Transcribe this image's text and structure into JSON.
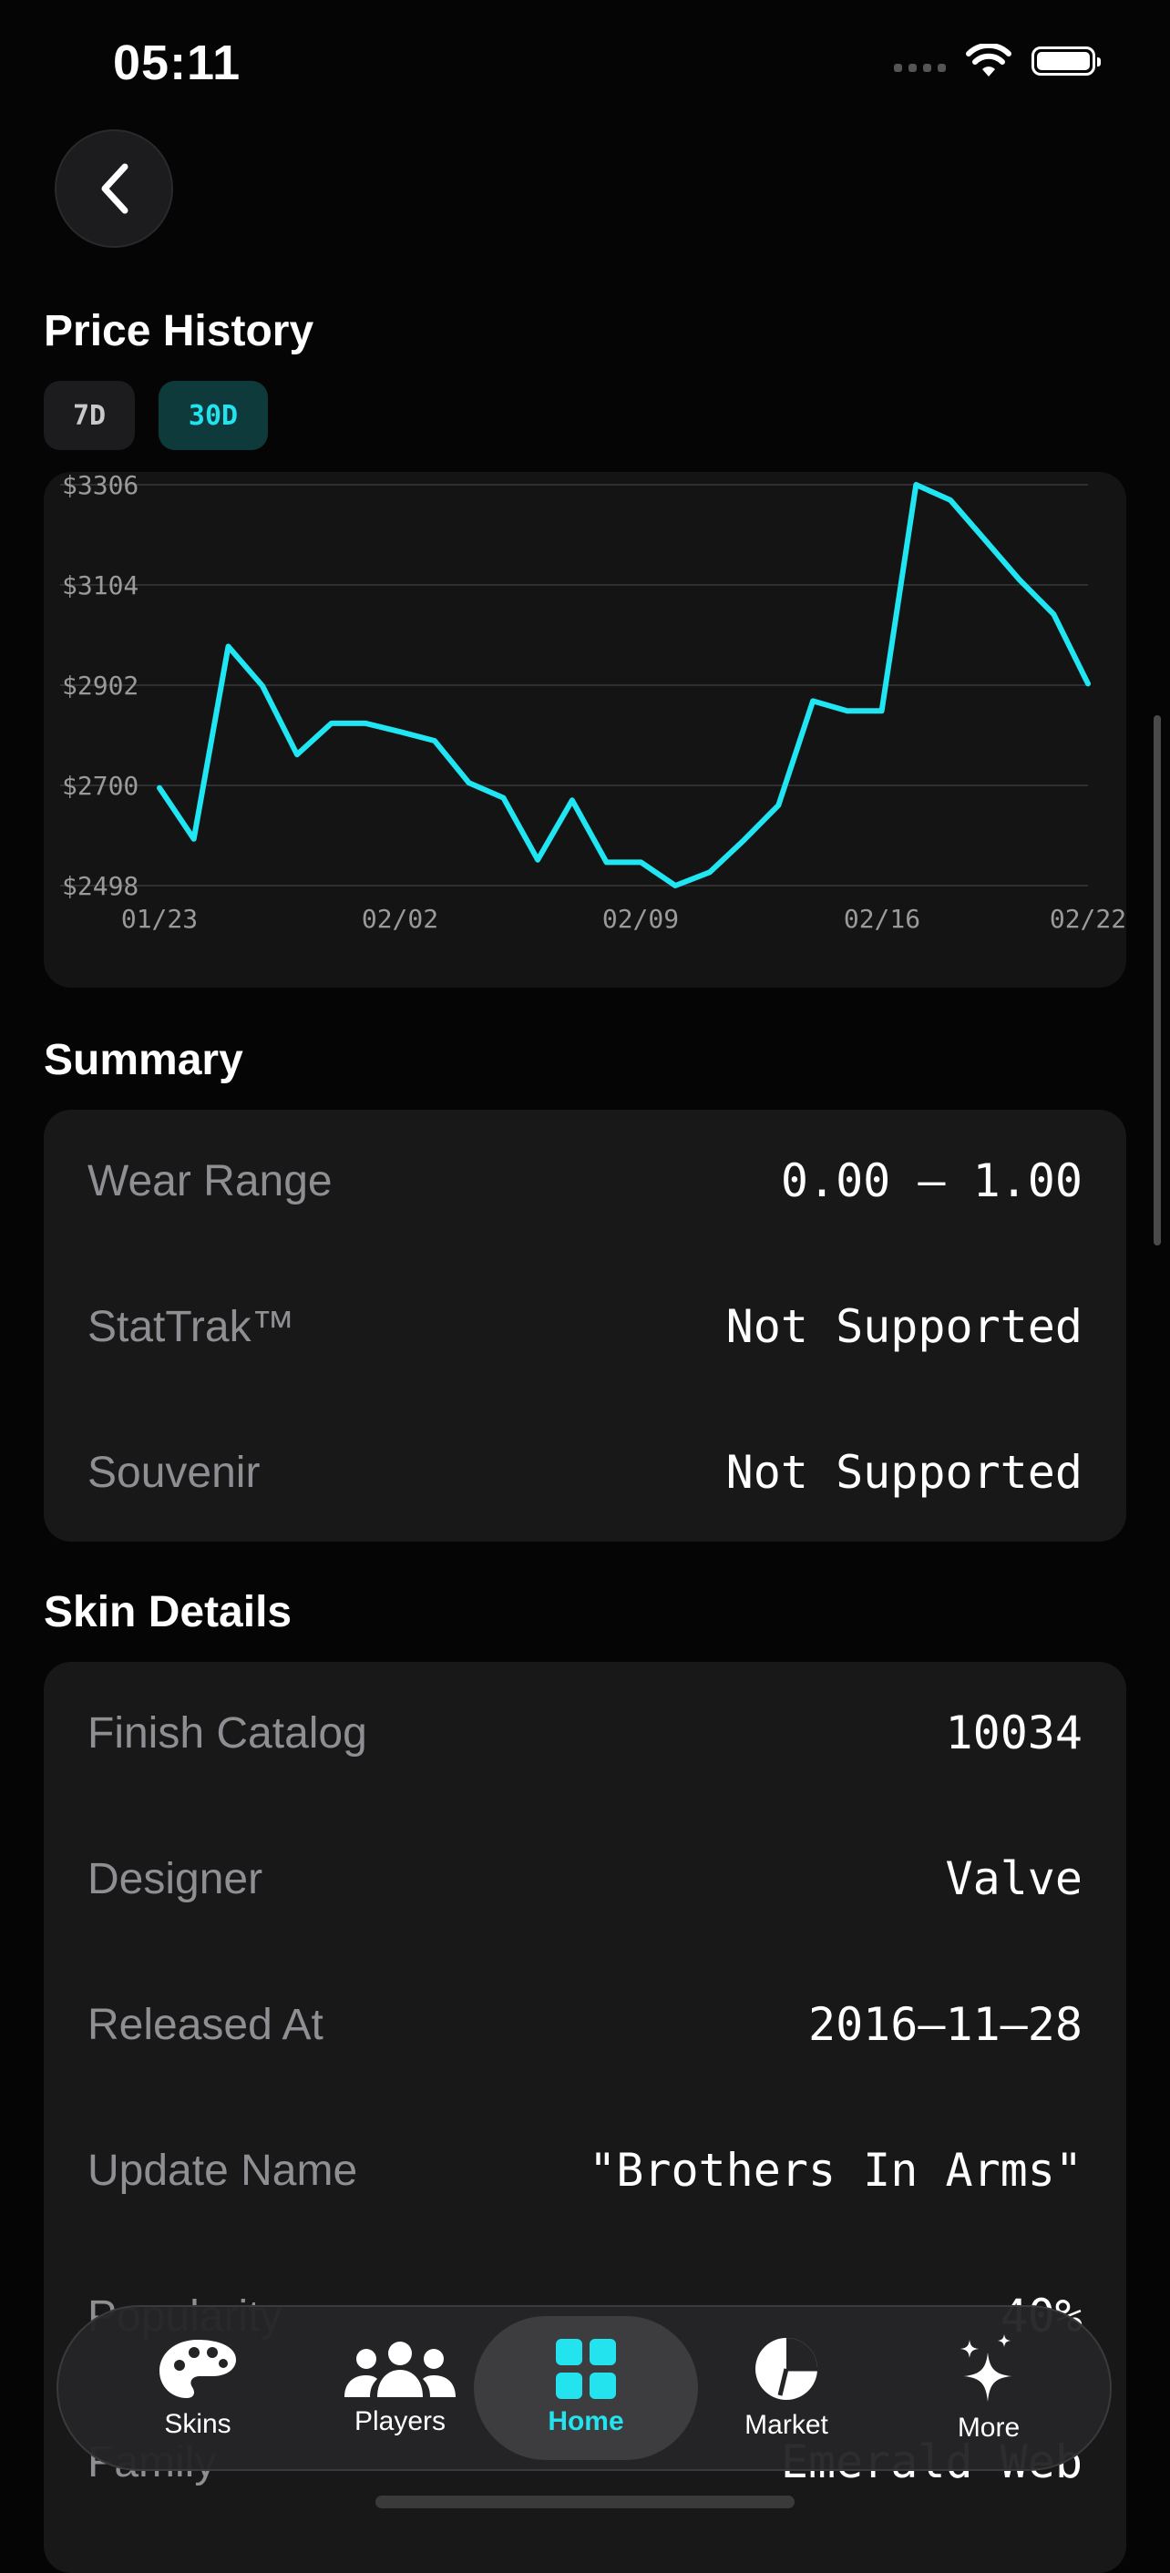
{
  "status_bar": {
    "time": "05:11"
  },
  "price_history": {
    "title": "Price History",
    "ranges": [
      "7D",
      "30D"
    ],
    "selected_range": "30D"
  },
  "chart_data": {
    "type": "line",
    "title": "",
    "xlabel": "",
    "ylabel": "",
    "y_ticks": [
      "$3306",
      "$3104",
      "$2902",
      "$2700",
      "$2498"
    ],
    "x_ticks": [
      "01/23",
      "02/02",
      "02/09",
      "02/16",
      "02/22"
    ],
    "ylim": [
      2498,
      3306
    ],
    "grid": true,
    "line_color": "#1fe6f2",
    "x": [
      "01/23",
      "01/24",
      "01/25",
      "01/26",
      "01/27",
      "01/28",
      "01/29",
      "01/30",
      "01/31",
      "02/01",
      "02/02",
      "02/03",
      "02/04",
      "02/05",
      "02/06",
      "02/07",
      "02/08",
      "02/09",
      "02/10",
      "02/11",
      "02/12",
      "02/13",
      "02/14",
      "02/15",
      "02/16",
      "02/17",
      "02/18",
      "02/19",
      "02/20",
      "02/21",
      "02/22"
    ],
    "values": [
      2695,
      2592,
      2980,
      2900,
      2762,
      2825,
      2825,
      2808,
      2790,
      2705,
      2675,
      2550,
      2670,
      2545,
      2545,
      2498,
      2525,
      2590,
      2660,
      2870,
      2850,
      2850,
      3306,
      3275,
      3195,
      3115,
      3045,
      2905
    ]
  },
  "summary": {
    "title": "Summary",
    "rows": [
      {
        "label": "Wear Range",
        "value": "0.00 – 1.00"
      },
      {
        "label": "StatTrak™",
        "value": "Not Supported"
      },
      {
        "label": "Souvenir",
        "value": "Not Supported"
      }
    ]
  },
  "skin_details": {
    "title": "Skin Details",
    "rows": [
      {
        "label": "Finish Catalog",
        "value": "10034"
      },
      {
        "label": "Designer",
        "value": "Valve"
      },
      {
        "label": "Released At",
        "value": "2016–11–28"
      },
      {
        "label": "Update Name",
        "value": "\"Brothers In Arms\""
      },
      {
        "label": "Popularity",
        "value": "40%"
      },
      {
        "label": "Family",
        "value": "Emerald Web"
      }
    ]
  },
  "tab_bar": {
    "tabs": [
      {
        "label": "Skins",
        "icon": "palette-icon"
      },
      {
        "label": "Players",
        "icon": "people-icon"
      },
      {
        "label": "Home",
        "icon": "grid-icon"
      },
      {
        "label": "Market",
        "icon": "pie-chart-icon"
      },
      {
        "label": "More",
        "icon": "sparkles-icon"
      }
    ],
    "active": "Home",
    "accent": "#23e3ef"
  }
}
